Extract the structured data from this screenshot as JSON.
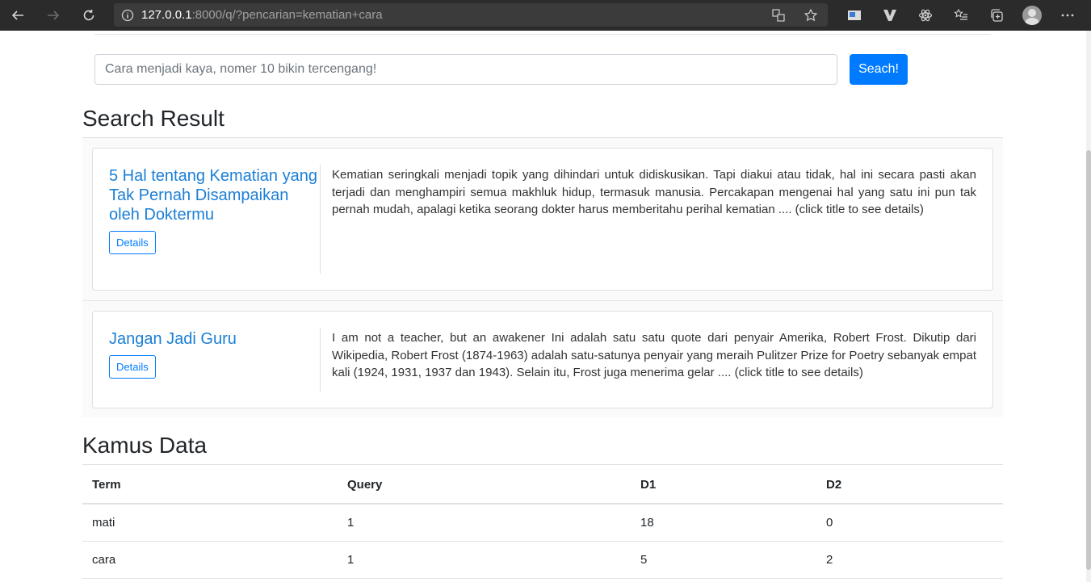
{
  "browser": {
    "url_host": "127.0.0.1",
    "url_rest": ":8000/q/?pencarian=kematian+cara",
    "icons": [
      "back-icon",
      "forward-icon",
      "refresh-icon",
      "info-icon",
      "translate-icon",
      "favorite-star-icon",
      "extension-icon",
      "vivaldi-icon",
      "react-icon",
      "favorites-list-icon",
      "collections-icon",
      "profile-avatar",
      "more-icon"
    ]
  },
  "search": {
    "placeholder": "Cara menjadi kaya, nomer 10 bikin tercengang!",
    "button_label": "Seach!"
  },
  "results": {
    "heading": "Search Result",
    "items": [
      {
        "title": "5 Hal tentang Kematian yang Tak Pernah Disampaikan oleh Doktermu",
        "details_label": "Details",
        "snippet": "Kematian seringkali menjadi topik yang dihindari untuk didiskusikan. Tapi diakui atau tidak, hal ini secara pasti akan terjadi dan menghampiri semua makhluk hidup, termasuk manusia. Percakapan mengenai hal yang satu ini pun tak pernah mudah, apalagi ketika seorang dokter harus memberitahu perihal kematian .... (click title to see details)"
      },
      {
        "title": "Jangan Jadi Guru",
        "details_label": "Details",
        "snippet": "I am not a teacher, but an awakener Ini adalah satu satu quote dari penyair Amerika, Robert Frost. Dikutip dari Wikipedia, Robert Frost (1874-1963) adalah satu-satunya penyair yang meraih Pulitzer Prize for Poetry sebanyak empat kali (1924, 1931, 1937 dan 1943). Selain itu, Frost juga menerima gelar .... (click title to see details)"
      }
    ]
  },
  "kamus": {
    "heading": "Kamus Data",
    "columns": [
      "Term",
      "Query",
      "D1",
      "D2"
    ],
    "rows": [
      [
        "mati",
        "1",
        "18",
        "0"
      ],
      [
        "cara",
        "1",
        "5",
        "2"
      ]
    ]
  },
  "colors": {
    "accent": "#007bff",
    "link": "#1a7fd6",
    "chrome": "#2b2b2b"
  }
}
